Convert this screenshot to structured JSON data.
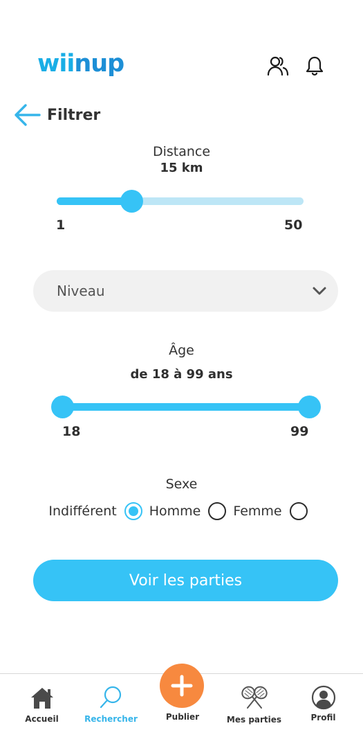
{
  "header": {
    "logo_part1": "wii",
    "logo_part2": "nup",
    "icons": [
      "users-icon",
      "bell-icon"
    ]
  },
  "page": {
    "title": "Filtrer",
    "back_icon": "arrow-left-icon"
  },
  "distance": {
    "label": "Distance",
    "value": "15 km",
    "min": "1",
    "max": "50",
    "current": 15
  },
  "level": {
    "placeholder": "Niveau",
    "icon": "chevron-down-icon"
  },
  "age": {
    "label": "Âge",
    "value": "de 18 à 99 ans",
    "min": "18",
    "max": "99"
  },
  "gender": {
    "label": "Sexe",
    "options": [
      {
        "label": "Indifférent",
        "selected": true
      },
      {
        "label": "Homme",
        "selected": false
      },
      {
        "label": "Femme",
        "selected": false
      }
    ]
  },
  "cta": {
    "label": "Voir les parties"
  },
  "colors": {
    "accent": "#36c3f6",
    "accent_light": "#bde6f6",
    "fab": "#f7893f",
    "brand": "#1d8fd6"
  },
  "nav": {
    "items": [
      {
        "label": "Accueil",
        "icon": "home-icon"
      },
      {
        "label": "Rechercher",
        "icon": "search-icon",
        "active": true
      },
      {
        "label": "Publier",
        "icon": "plus-icon"
      },
      {
        "label": "Mes parties",
        "icon": "rackets-icon"
      },
      {
        "label": "Profil",
        "icon": "profile-icon"
      }
    ]
  }
}
